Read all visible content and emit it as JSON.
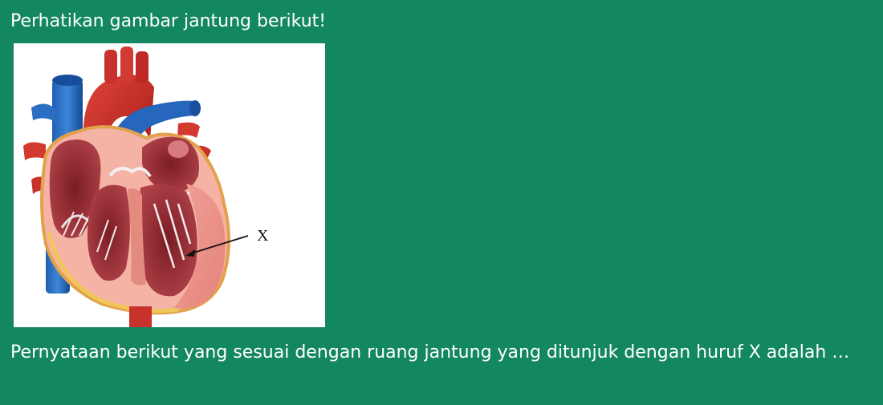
{
  "page": {
    "background": "#138762",
    "text_color": "#ffffff"
  },
  "heading": "Perhatikan gambar jantung berikut!",
  "figure": {
    "alt": "heart-cross-section-illustration",
    "label": "X"
  },
  "question": "Pernyataan berikut yang sesuai dengan ruang jantung yang ditunjuk dengan huruf X adalah …"
}
